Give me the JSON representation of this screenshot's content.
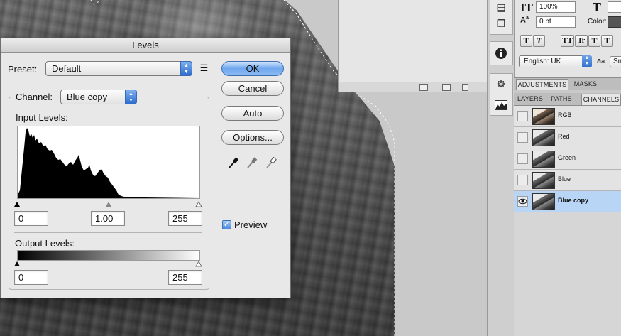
{
  "levels": {
    "title": "Levels",
    "preset_label": "Preset:",
    "preset_value": "Default",
    "channel_label": "Channel:",
    "channel_value": "Blue copy",
    "input_levels_label": "Input Levels:",
    "output_levels_label": "Output Levels:",
    "input_black": "0",
    "input_gamma": "1.00",
    "input_white": "255",
    "output_black": "0",
    "output_white": "255",
    "buttons": {
      "ok": "OK",
      "cancel": "Cancel",
      "auto": "Auto",
      "options": "Options..."
    },
    "preview_label": "Preview",
    "preview_checked": true
  },
  "character": {
    "vertical_scale": "100%",
    "baseline_shift": "0 pt",
    "color_label": "Color:",
    "language": "English: UK",
    "aa_label": "a",
    "aa_value": "Sm",
    "style_buttons": [
      "T",
      "T",
      "TT",
      "Tr",
      "T",
      "T"
    ]
  },
  "panels": {
    "adjust_tabs": [
      "ADJUSTMENTS",
      "MASKS"
    ],
    "layer_tabs": [
      "LAYERS",
      "PATHS",
      "CHANNELS"
    ],
    "channels": [
      {
        "name": "RGB",
        "visible": false,
        "selected": false
      },
      {
        "name": "Red",
        "visible": false,
        "selected": false
      },
      {
        "name": "Green",
        "visible": false,
        "selected": false
      },
      {
        "name": "Blue",
        "visible": false,
        "selected": false
      },
      {
        "name": "Blue copy",
        "visible": true,
        "selected": true
      }
    ]
  },
  "colors": {
    "accent": "#3f7fdc",
    "selection": "#b9d5f5",
    "dialog_bg": "#e8e8e8"
  }
}
